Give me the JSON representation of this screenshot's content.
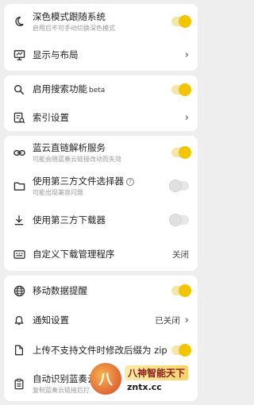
{
  "colors": {
    "accent": "#f2c500",
    "background": "#eeeeee",
    "card": "#ffffff"
  },
  "display_group": {
    "dark_mode": {
      "title": "深色模式跟随系统",
      "subtitle": "启用后不可手动切换深色模式",
      "enabled": true,
      "icon": "moon-icon"
    },
    "layout": {
      "title": "显示与布局",
      "icon": "monitor-layout-icon"
    }
  },
  "search_group": {
    "enable_search": {
      "title": "启用搜索功能",
      "badge": "beta",
      "enabled": true,
      "icon": "search-icon"
    },
    "index_settings": {
      "title": "索引设置",
      "icon": "index-search-icon"
    }
  },
  "download_group": {
    "direct_link": {
      "title": "蓝云直链解析服务",
      "subtitle": "可能会随蓝奏云链接改动而失效",
      "enabled": true,
      "icon": "link-icon"
    },
    "file_picker": {
      "title": "使用第三方文件选择器",
      "help": "?",
      "subtitle": "可能出现兼容问题",
      "enabled": false,
      "icon": "folder-icon"
    },
    "downloader": {
      "title": "使用第三方下载器",
      "enabled": false,
      "icon": "download-icon"
    },
    "custom_download_manager": {
      "title": "自定义下载管理程序",
      "value": "关闭",
      "icon": "keyboard-icon"
    }
  },
  "misc_group": {
    "mobile_data": {
      "title": "移动数据提醒",
      "enabled": true,
      "icon": "globe-icon"
    },
    "notifications": {
      "title": "通知设置",
      "value": "已关闭",
      "icon": "bell-icon"
    },
    "zip_suffix": {
      "title": "上传不支持文件时修改后缀为 zip",
      "enabled": true,
      "icon": "file-icon"
    },
    "auto_detect": {
      "title": "自动识别蓝奏云链接",
      "subtitle": "复制蓝奏云链接后打",
      "icon": "clipboard-icon"
    }
  },
  "watermark": {
    "logo": "八",
    "title": "八神智能天下",
    "url": "zntx.cc"
  }
}
